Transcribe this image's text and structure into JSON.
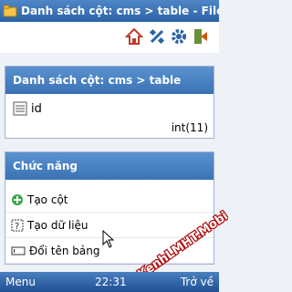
{
  "window": {
    "title": "Danh sách cột: cms > table - File"
  },
  "toolbar": {
    "icons": [
      "home-icon",
      "satellite-icon",
      "gear-icon",
      "exit-icon"
    ]
  },
  "columns_panel": {
    "header": "Danh sách cột: cms > table",
    "rows": [
      {
        "name": "id",
        "type": "int(11)"
      }
    ]
  },
  "functions_panel": {
    "header": "Chức năng",
    "items": [
      {
        "label": "Tạo cột",
        "icon": "add-icon"
      },
      {
        "label": "Tạo dữ liệu",
        "icon": "data-icon"
      },
      {
        "label": "Đổi tên bảng",
        "icon": "rename-icon"
      }
    ]
  },
  "softkeys": {
    "left": "Menu",
    "time": "22:31",
    "right": "Trở về"
  },
  "watermark": {
    "text": "KenhLMHT.Mobi"
  },
  "colors": {
    "accent": "#3a72b6",
    "background": "#eef1f6"
  }
}
